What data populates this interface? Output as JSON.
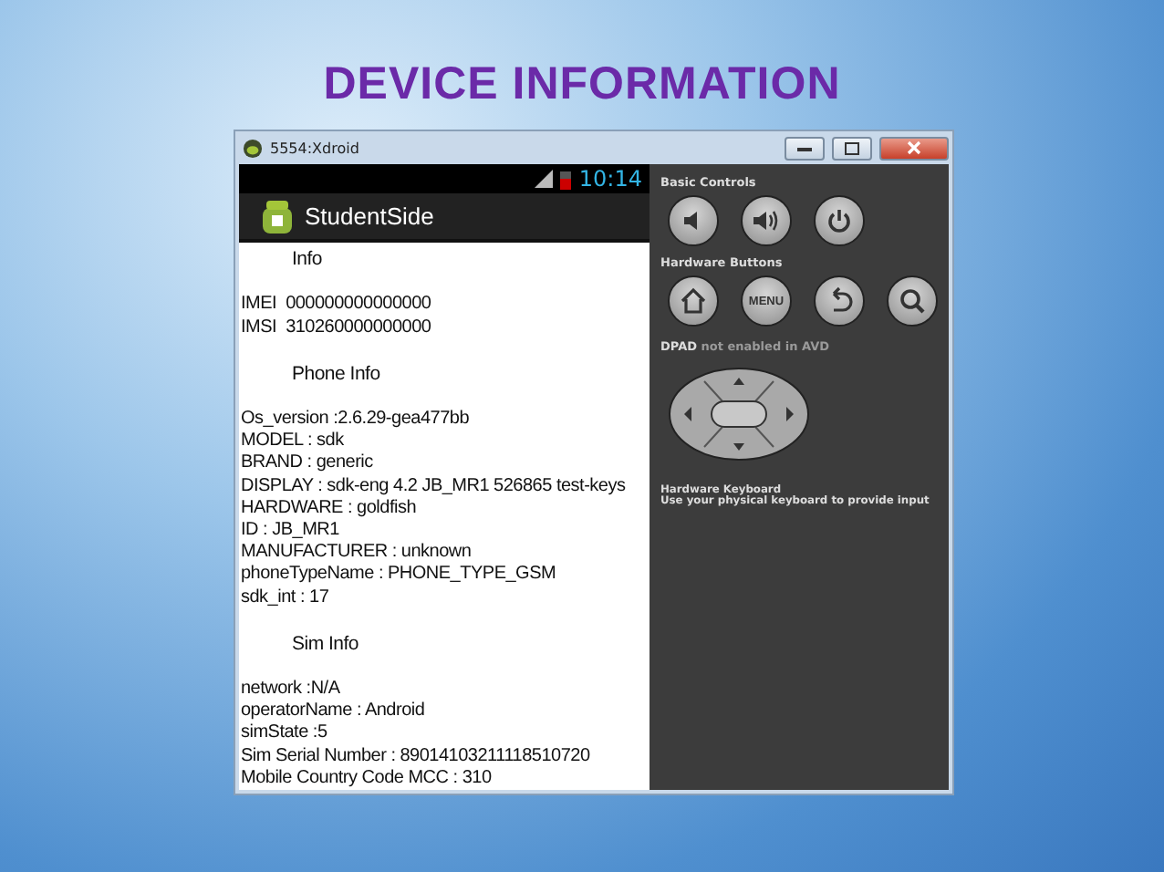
{
  "slide": {
    "title": "DEVICE INFORMATION"
  },
  "window": {
    "title": "5554:Xdroid"
  },
  "phone": {
    "status_bar": {
      "time": "10:14"
    },
    "app_bar": {
      "title": "StudentSide"
    },
    "content": [
      {
        "kind": "heading",
        "text": "Info"
      },
      {
        "kind": "pair",
        "label": "IMEI",
        "value": "000000000000000"
      },
      {
        "kind": "pair",
        "label": "IMSI",
        "value": "310260000000000"
      },
      {
        "kind": "heading",
        "text": "Phone Info"
      },
      {
        "kind": "line",
        "text": "Os_version :2.6.29-gea477bb"
      },
      {
        "kind": "line",
        "text": "MODEL : sdk"
      },
      {
        "kind": "line",
        "text": "BRAND : generic"
      },
      {
        "kind": "line",
        "text": "DISPLAY : sdk-eng 4.2 JB_MR1 526865 test-keys"
      },
      {
        "kind": "line",
        "text": "HARDWARE : goldfish"
      },
      {
        "kind": "line",
        "text": "ID : JB_MR1"
      },
      {
        "kind": "line",
        "text": "MANUFACTURER : unknown"
      },
      {
        "kind": "line",
        "text": "phoneTypeName : PHONE_TYPE_GSM"
      },
      {
        "kind": "line",
        "text": "sdk_int : 17"
      },
      {
        "kind": "heading",
        "text": "Sim Info"
      },
      {
        "kind": "line",
        "text": "network :N/A"
      },
      {
        "kind": "line",
        "text": "operatorName : Android"
      },
      {
        "kind": "line",
        "text": "simState :5"
      },
      {
        "kind": "line",
        "text": "Sim Serial Number : 89014103211118510720"
      },
      {
        "kind": "line",
        "text": "Mobile Country Code MCC : 310"
      }
    ]
  },
  "controls": {
    "basic": {
      "title": "Basic Controls",
      "buttons": [
        {
          "kind": "volume-down"
        },
        {
          "kind": "volume-up"
        },
        {
          "kind": "power"
        }
      ]
    },
    "hardware": {
      "title": "Hardware Buttons",
      "buttons": [
        {
          "kind": "home"
        },
        {
          "kind": "menu",
          "label": "MENU"
        },
        {
          "kind": "back"
        },
        {
          "kind": "search"
        }
      ]
    },
    "dpad": {
      "label": "DPAD",
      "note": "not enabled in AVD"
    },
    "keyboard": {
      "title": "Hardware Keyboard",
      "note": "Use your physical keyboard to provide input"
    }
  }
}
